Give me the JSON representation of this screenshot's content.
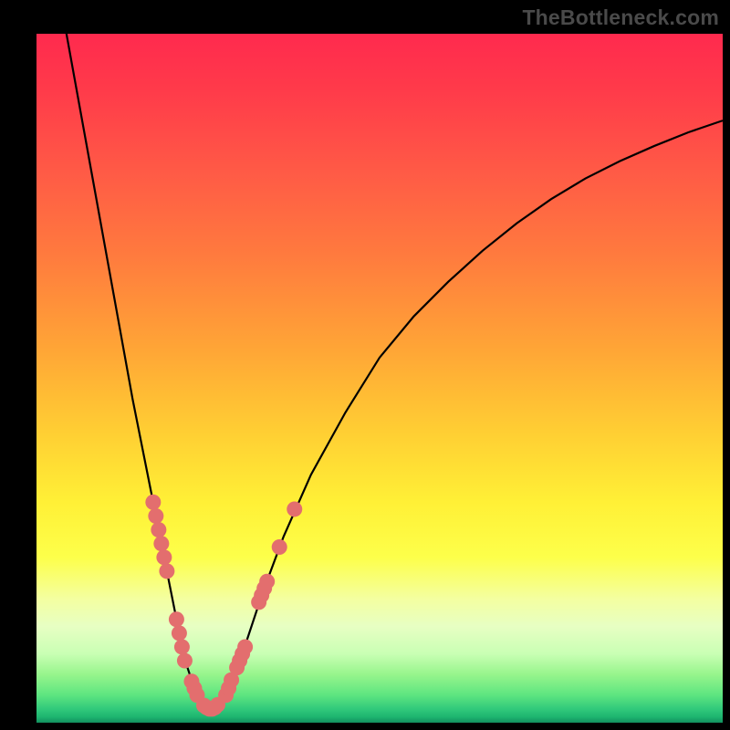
{
  "watermark": "TheBottleneck.com",
  "chart_data": {
    "type": "line",
    "title": "",
    "xlabel": "",
    "ylabel": "",
    "xlim": [
      0,
      100
    ],
    "ylim": [
      0,
      100
    ],
    "grid": false,
    "series": [
      {
        "name": "curve",
        "x": [
          4,
          6,
          8,
          10,
          12,
          14,
          16,
          17,
          18,
          19,
          20,
          21,
          22,
          23,
          24,
          25,
          26,
          27,
          28,
          30,
          33,
          36,
          40,
          45,
          50,
          55,
          60,
          65,
          70,
          75,
          80,
          85,
          90,
          95,
          100
        ],
        "y": [
          102,
          91,
          80,
          69,
          58,
          47,
          37,
          32,
          27,
          22,
          17,
          12,
          8,
          5,
          3,
          2,
          2,
          3,
          5,
          10,
          19,
          27,
          36,
          45,
          53,
          59,
          64,
          68.5,
          72.5,
          76,
          79,
          81.5,
          83.7,
          85.7,
          87.4
        ]
      }
    ],
    "points": [
      {
        "x": 17.0,
        "y": 32.0
      },
      {
        "x": 17.4,
        "y": 30.0
      },
      {
        "x": 17.8,
        "y": 28.0
      },
      {
        "x": 18.2,
        "y": 26.0
      },
      {
        "x": 18.6,
        "y": 24.0
      },
      {
        "x": 19.0,
        "y": 22.0
      },
      {
        "x": 20.4,
        "y": 15.0
      },
      {
        "x": 20.8,
        "y": 13.0
      },
      {
        "x": 21.2,
        "y": 11.0
      },
      {
        "x": 21.6,
        "y": 9.0
      },
      {
        "x": 22.6,
        "y": 6.0
      },
      {
        "x": 23.0,
        "y": 5.0
      },
      {
        "x": 23.4,
        "y": 4.0
      },
      {
        "x": 24.4,
        "y": 2.5
      },
      {
        "x": 24.8,
        "y": 2.2
      },
      {
        "x": 25.2,
        "y": 2.0
      },
      {
        "x": 25.6,
        "y": 2.0
      },
      {
        "x": 26.0,
        "y": 2.2
      },
      {
        "x": 26.4,
        "y": 2.6
      },
      {
        "x": 27.6,
        "y": 4.0
      },
      {
        "x": 28.0,
        "y": 5.0
      },
      {
        "x": 28.4,
        "y": 6.2
      },
      {
        "x": 29.2,
        "y": 8.0
      },
      {
        "x": 29.6,
        "y": 9.0
      },
      {
        "x": 30.0,
        "y": 10.0
      },
      {
        "x": 30.4,
        "y": 11.0
      },
      {
        "x": 32.4,
        "y": 17.5
      },
      {
        "x": 32.8,
        "y": 18.5
      },
      {
        "x": 33.2,
        "y": 19.5
      },
      {
        "x": 33.6,
        "y": 20.5
      },
      {
        "x": 35.4,
        "y": 25.5
      },
      {
        "x": 37.6,
        "y": 31.0
      }
    ],
    "colors": {
      "curve": "#000000",
      "points": "#e36e6e"
    }
  }
}
